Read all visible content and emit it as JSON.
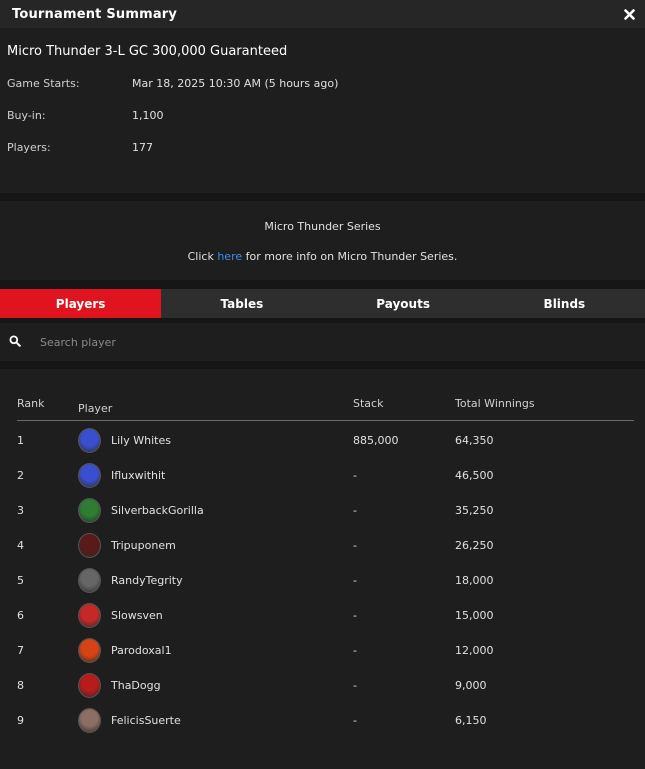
{
  "window": {
    "title": "Tournament Summary"
  },
  "tournament": {
    "name": "Micro Thunder 3-L GC 300,000 Guaranteed",
    "fields": [
      {
        "label": "Game Starts:",
        "value": "Mar 18, 2025 10:30 AM (5 hours ago)"
      },
      {
        "label": "Buy-in:",
        "value": "1,100"
      },
      {
        "label": "Players:",
        "value": "177"
      }
    ]
  },
  "series": {
    "name": "Micro Thunder Series",
    "info_prefix": "Click ",
    "info_link": "here",
    "info_suffix": " for more info on Micro Thunder Series."
  },
  "tabs": [
    {
      "label": "Players",
      "active": true
    },
    {
      "label": "Tables",
      "active": false
    },
    {
      "label": "Payouts",
      "active": false
    },
    {
      "label": "Blinds",
      "active": false
    }
  ],
  "search": {
    "placeholder": "Search player"
  },
  "table": {
    "headers": {
      "rank": "Rank",
      "player": "Player",
      "stack": "Stack",
      "winnings": "Total Winnings"
    },
    "rows": [
      {
        "rank": "1",
        "player": "Lily Whites",
        "stack": "885,000",
        "winnings": "64,350",
        "avatar_color": "#3a4fd0"
      },
      {
        "rank": "2",
        "player": "Ifluxwithit",
        "stack": "-",
        "winnings": "46,500",
        "avatar_color": "#3a4fd0"
      },
      {
        "rank": "3",
        "player": "SilverbackGorilla",
        "stack": "-",
        "winnings": "35,250",
        "avatar_color": "#2e7d32"
      },
      {
        "rank": "4",
        "player": "Tripuponem",
        "stack": "-",
        "winnings": "26,250",
        "avatar_color": "#5a1a1a"
      },
      {
        "rank": "5",
        "player": "RandyTegrity",
        "stack": "-",
        "winnings": "18,000",
        "avatar_color": "#666666"
      },
      {
        "rank": "6",
        "player": "Slowsven",
        "stack": "-",
        "winnings": "15,000",
        "avatar_color": "#c62828"
      },
      {
        "rank": "7",
        "player": "Parodoxal1",
        "stack": "-",
        "winnings": "12,000",
        "avatar_color": "#d84315"
      },
      {
        "rank": "8",
        "player": "ThaDogg",
        "stack": "-",
        "winnings": "9,000",
        "avatar_color": "#b71c1c"
      },
      {
        "rank": "9",
        "player": "FelicisSuerte",
        "stack": "-",
        "winnings": "6,150",
        "avatar_color": "#8d6e63"
      }
    ]
  }
}
